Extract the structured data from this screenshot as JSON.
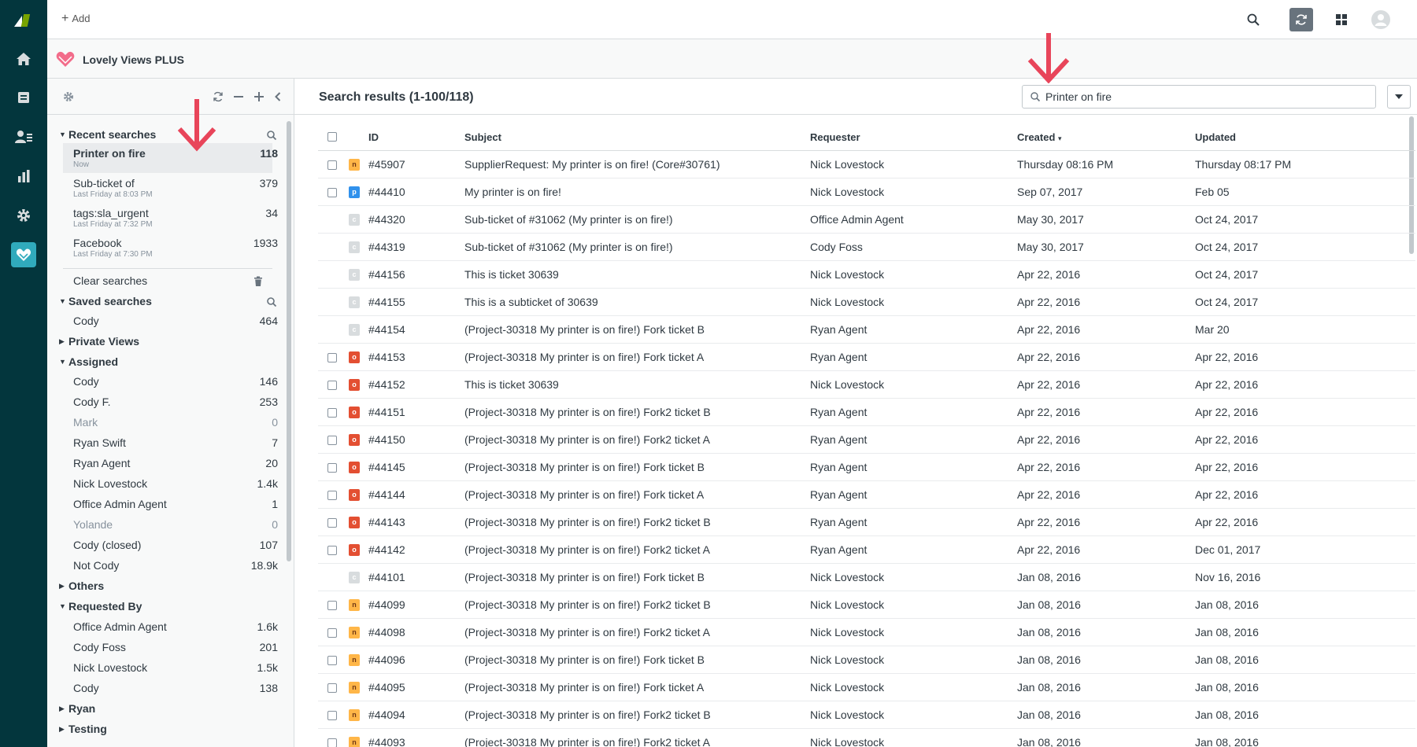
{
  "topbar": {
    "add_label": "Add"
  },
  "app": {
    "title": "Lovely Views PLUS"
  },
  "sidebar": {
    "recent": {
      "title": "Recent searches",
      "items": [
        {
          "label": "Printer on fire",
          "sub": "Now",
          "count": "118"
        },
        {
          "label": "Sub-ticket of",
          "sub": "Last Friday at 8:03 PM",
          "count": "379"
        },
        {
          "label": "tags:sla_urgent",
          "sub": "Last Friday at 7:32 PM",
          "count": "34"
        },
        {
          "label": "Facebook",
          "sub": "Last Friday at 7:30 PM",
          "count": "1933"
        }
      ],
      "clear_label": "Clear searches"
    },
    "saved": {
      "title": "Saved searches",
      "items": [
        {
          "label": "Cody",
          "count": "464"
        }
      ]
    },
    "private": {
      "title": "Private Views"
    },
    "assigned": {
      "title": "Assigned",
      "items": [
        {
          "label": "Cody",
          "count": "146"
        },
        {
          "label": "Cody F.",
          "count": "253"
        },
        {
          "label": "Mark",
          "count": "0"
        },
        {
          "label": "Ryan Swift",
          "count": "7"
        },
        {
          "label": "Ryan Agent",
          "count": "20"
        },
        {
          "label": "Nick Lovestock",
          "count": "1.4k"
        },
        {
          "label": "Office Admin Agent",
          "count": "1"
        },
        {
          "label": "Yolande",
          "count": "0"
        },
        {
          "label": "Cody (closed)",
          "count": "107"
        },
        {
          "label": "Not Cody",
          "count": "18.9k"
        }
      ]
    },
    "others": {
      "title": "Others"
    },
    "requested": {
      "title": "Requested By",
      "items": [
        {
          "label": "Office Admin Agent",
          "count": "1.6k"
        },
        {
          "label": "Cody Foss",
          "count": "201"
        },
        {
          "label": "Nick Lovestock",
          "count": "1.5k"
        },
        {
          "label": "Cody",
          "count": "138"
        }
      ]
    },
    "ryan": {
      "title": "Ryan"
    },
    "testing": {
      "title": "Testing"
    }
  },
  "main": {
    "results_title": "Search results (1-100/118)",
    "search_value": "Printer on fire",
    "columns": {
      "id": "ID",
      "subject": "Subject",
      "requester": "Requester",
      "created": "Created",
      "created_sort": "▾",
      "updated": "Updated"
    },
    "rows": [
      {
        "status": "n",
        "id": "#45907",
        "subject": "SupplierRequest: My printer is on fire! (Core#30761)",
        "requester": "Nick Lovestock",
        "created": "Thursday 08:16 PM",
        "updated": "Thursday 08:17 PM"
      },
      {
        "status": "p",
        "id": "#44410",
        "subject": "My printer is on fire!",
        "requester": "Nick Lovestock",
        "created": "Sep 07, 2017",
        "updated": "Feb 05"
      },
      {
        "status": "c",
        "id": "#44320",
        "subject": "Sub-ticket of #31062 (My printer is on fire!)",
        "requester": "Office Admin Agent",
        "created": "May 30, 2017",
        "updated": "Oct 24, 2017"
      },
      {
        "status": "c",
        "id": "#44319",
        "subject": "Sub-ticket of #31062 (My printer is on fire!)",
        "requester": "Cody Foss",
        "created": "May 30, 2017",
        "updated": "Oct 24, 2017"
      },
      {
        "status": "c",
        "id": "#44156",
        "subject": "This is ticket 30639",
        "requester": "Nick Lovestock",
        "created": "Apr 22, 2016",
        "updated": "Oct 24, 2017"
      },
      {
        "status": "c",
        "id": "#44155",
        "subject": "This is a subticket of 30639",
        "requester": "Nick Lovestock",
        "created": "Apr 22, 2016",
        "updated": "Oct 24, 2017"
      },
      {
        "status": "c",
        "id": "#44154",
        "subject": "(Project-30318 My printer is on fire!) Fork ticket B",
        "requester": "Ryan Agent",
        "created": "Apr 22, 2016",
        "updated": "Mar 20"
      },
      {
        "status": "o",
        "id": "#44153",
        "subject": "(Project-30318 My printer is on fire!) Fork ticket A",
        "requester": "Ryan Agent",
        "created": "Apr 22, 2016",
        "updated": "Apr 22, 2016"
      },
      {
        "status": "o",
        "id": "#44152",
        "subject": "This is ticket 30639",
        "requester": "Nick Lovestock",
        "created": "Apr 22, 2016",
        "updated": "Apr 22, 2016"
      },
      {
        "status": "o",
        "id": "#44151",
        "subject": "(Project-30318 My printer is on fire!) Fork2 ticket B",
        "requester": "Ryan Agent",
        "created": "Apr 22, 2016",
        "updated": "Apr 22, 2016"
      },
      {
        "status": "o",
        "id": "#44150",
        "subject": "(Project-30318 My printer is on fire!) Fork2 ticket A",
        "requester": "Ryan Agent",
        "created": "Apr 22, 2016",
        "updated": "Apr 22, 2016"
      },
      {
        "status": "o",
        "id": "#44145",
        "subject": "(Project-30318 My printer is on fire!) Fork ticket B",
        "requester": "Ryan Agent",
        "created": "Apr 22, 2016",
        "updated": "Apr 22, 2016"
      },
      {
        "status": "o",
        "id": "#44144",
        "subject": "(Project-30318 My printer is on fire!) Fork ticket A",
        "requester": "Ryan Agent",
        "created": "Apr 22, 2016",
        "updated": "Apr 22, 2016"
      },
      {
        "status": "o",
        "id": "#44143",
        "subject": "(Project-30318 My printer is on fire!) Fork2 ticket B",
        "requester": "Ryan Agent",
        "created": "Apr 22, 2016",
        "updated": "Apr 22, 2016"
      },
      {
        "status": "o",
        "id": "#44142",
        "subject": "(Project-30318 My printer is on fire!) Fork2 ticket A",
        "requester": "Ryan Agent",
        "created": "Apr 22, 2016",
        "updated": "Dec 01, 2017"
      },
      {
        "status": "c",
        "id": "#44101",
        "subject": "(Project-30318 My printer is on fire!) Fork ticket B",
        "requester": "Nick Lovestock",
        "created": "Jan 08, 2016",
        "updated": "Nov 16, 2016"
      },
      {
        "status": "n",
        "id": "#44099",
        "subject": "(Project-30318 My printer is on fire!) Fork2 ticket B",
        "requester": "Nick Lovestock",
        "created": "Jan 08, 2016",
        "updated": "Jan 08, 2016"
      },
      {
        "status": "n",
        "id": "#44098",
        "subject": "(Project-30318 My printer is on fire!) Fork2 ticket A",
        "requester": "Nick Lovestock",
        "created": "Jan 08, 2016",
        "updated": "Jan 08, 2016"
      },
      {
        "status": "n",
        "id": "#44096",
        "subject": "(Project-30318 My printer is on fire!) Fork ticket B",
        "requester": "Nick Lovestock",
        "created": "Jan 08, 2016",
        "updated": "Jan 08, 2016"
      },
      {
        "status": "n",
        "id": "#44095",
        "subject": "(Project-30318 My printer is on fire!) Fork ticket A",
        "requester": "Nick Lovestock",
        "created": "Jan 08, 2016",
        "updated": "Jan 08, 2016"
      },
      {
        "status": "n",
        "id": "#44094",
        "subject": "(Project-30318 My printer is on fire!) Fork2 ticket B",
        "requester": "Nick Lovestock",
        "created": "Jan 08, 2016",
        "updated": "Jan 08, 2016"
      },
      {
        "status": "n",
        "id": "#44093",
        "subject": "(Project-30318 My printer is on fire!) Fork2 ticket A",
        "requester": "Nick Lovestock",
        "created": "Jan 08, 2016",
        "updated": "Jan 08, 2016"
      }
    ]
  },
  "colors": {
    "nav_bg": "#03363d",
    "active": "#30aabc",
    "status_new": "#ffb648",
    "status_open": "#e34f32",
    "status_pending": "#3091ec",
    "status_closed": "#d8dcde",
    "arrow": "#e8455a"
  }
}
